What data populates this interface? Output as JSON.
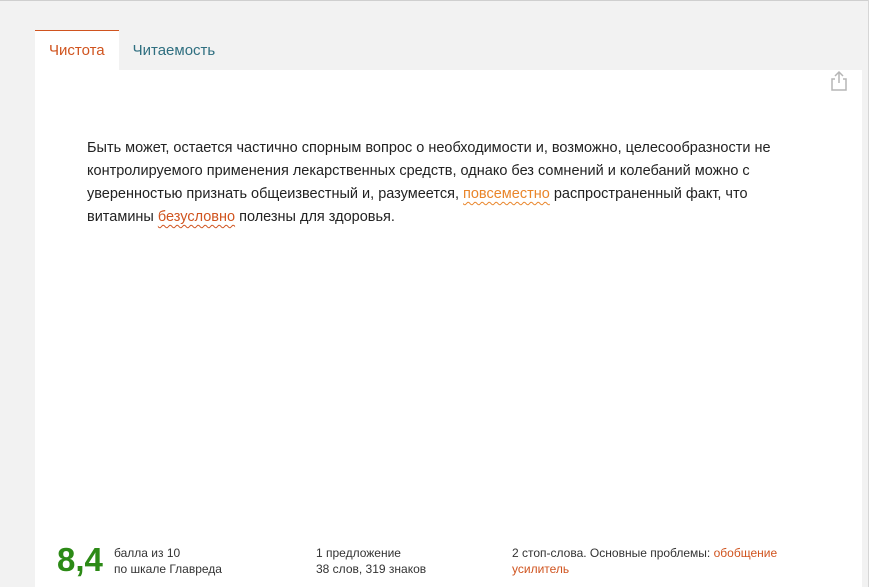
{
  "tabs": [
    {
      "label": "Чистота",
      "active": true
    },
    {
      "label": "Читаемость",
      "active": false
    }
  ],
  "share_icon": "share-icon",
  "text": {
    "part1": "Быть может, остается частично спорным вопрос о необходимости и, возможно, целесообразности не контролируемого применения лекарственных средств, однако без сомнений и колебаний можно с уверенностью признать общеизвестный и, разумеется, ",
    "highlight1": "повсеместно",
    "part2": " распространенный факт, что витамины ",
    "highlight2": "безусловно",
    "part3": " полезны для здоровья."
  },
  "footer": {
    "score": "8,4",
    "score_line1": "балла из 10",
    "score_line2": "по шкале Главреда",
    "stats_line1": "1 предложение",
    "stats_line2": "38 слов, 319 знаков",
    "issues_prefix": "2 стоп-слова. Основные проблемы: ",
    "issue1": "обобщение",
    "issue2": "усилитель"
  },
  "colors": {
    "accent": "#d0541f",
    "score": "#2c8a16",
    "highlight": "#e9852a",
    "tab_inactive": "#2f6f80"
  }
}
